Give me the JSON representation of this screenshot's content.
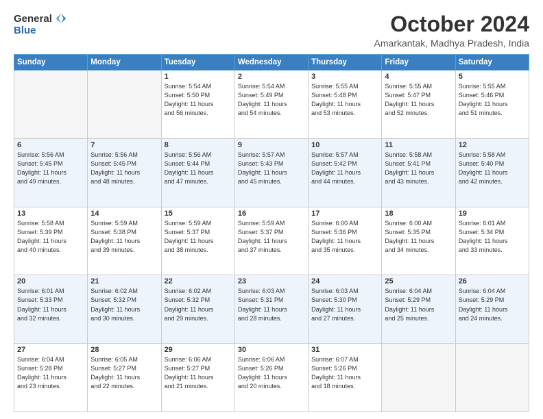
{
  "logo": {
    "general": "General",
    "blue": "Blue"
  },
  "header": {
    "month_year": "October 2024",
    "location": "Amarkantak, Madhya Pradesh, India"
  },
  "weekdays": [
    "Sunday",
    "Monday",
    "Tuesday",
    "Wednesday",
    "Thursday",
    "Friday",
    "Saturday"
  ],
  "weeks": [
    [
      {
        "day": "",
        "info": ""
      },
      {
        "day": "",
        "info": ""
      },
      {
        "day": "1",
        "info": "Sunrise: 5:54 AM\nSunset: 5:50 PM\nDaylight: 11 hours\nand 56 minutes."
      },
      {
        "day": "2",
        "info": "Sunrise: 5:54 AM\nSunset: 5:49 PM\nDaylight: 11 hours\nand 54 minutes."
      },
      {
        "day": "3",
        "info": "Sunrise: 5:55 AM\nSunset: 5:48 PM\nDaylight: 11 hours\nand 53 minutes."
      },
      {
        "day": "4",
        "info": "Sunrise: 5:55 AM\nSunset: 5:47 PM\nDaylight: 11 hours\nand 52 minutes."
      },
      {
        "day": "5",
        "info": "Sunrise: 5:55 AM\nSunset: 5:46 PM\nDaylight: 11 hours\nand 51 minutes."
      }
    ],
    [
      {
        "day": "6",
        "info": "Sunrise: 5:56 AM\nSunset: 5:45 PM\nDaylight: 11 hours\nand 49 minutes."
      },
      {
        "day": "7",
        "info": "Sunrise: 5:56 AM\nSunset: 5:45 PM\nDaylight: 11 hours\nand 48 minutes."
      },
      {
        "day": "8",
        "info": "Sunrise: 5:56 AM\nSunset: 5:44 PM\nDaylight: 11 hours\nand 47 minutes."
      },
      {
        "day": "9",
        "info": "Sunrise: 5:57 AM\nSunset: 5:43 PM\nDaylight: 11 hours\nand 45 minutes."
      },
      {
        "day": "10",
        "info": "Sunrise: 5:57 AM\nSunset: 5:42 PM\nDaylight: 11 hours\nand 44 minutes."
      },
      {
        "day": "11",
        "info": "Sunrise: 5:58 AM\nSunset: 5:41 PM\nDaylight: 11 hours\nand 43 minutes."
      },
      {
        "day": "12",
        "info": "Sunrise: 5:58 AM\nSunset: 5:40 PM\nDaylight: 11 hours\nand 42 minutes."
      }
    ],
    [
      {
        "day": "13",
        "info": "Sunrise: 5:58 AM\nSunset: 5:39 PM\nDaylight: 11 hours\nand 40 minutes."
      },
      {
        "day": "14",
        "info": "Sunrise: 5:59 AM\nSunset: 5:38 PM\nDaylight: 11 hours\nand 39 minutes."
      },
      {
        "day": "15",
        "info": "Sunrise: 5:59 AM\nSunset: 5:37 PM\nDaylight: 11 hours\nand 38 minutes."
      },
      {
        "day": "16",
        "info": "Sunrise: 5:59 AM\nSunset: 5:37 PM\nDaylight: 11 hours\nand 37 minutes."
      },
      {
        "day": "17",
        "info": "Sunrise: 6:00 AM\nSunset: 5:36 PM\nDaylight: 11 hours\nand 35 minutes."
      },
      {
        "day": "18",
        "info": "Sunrise: 6:00 AM\nSunset: 5:35 PM\nDaylight: 11 hours\nand 34 minutes."
      },
      {
        "day": "19",
        "info": "Sunrise: 6:01 AM\nSunset: 5:34 PM\nDaylight: 11 hours\nand 33 minutes."
      }
    ],
    [
      {
        "day": "20",
        "info": "Sunrise: 6:01 AM\nSunset: 5:33 PM\nDaylight: 11 hours\nand 32 minutes."
      },
      {
        "day": "21",
        "info": "Sunrise: 6:02 AM\nSunset: 5:32 PM\nDaylight: 11 hours\nand 30 minutes."
      },
      {
        "day": "22",
        "info": "Sunrise: 6:02 AM\nSunset: 5:32 PM\nDaylight: 11 hours\nand 29 minutes."
      },
      {
        "day": "23",
        "info": "Sunrise: 6:03 AM\nSunset: 5:31 PM\nDaylight: 11 hours\nand 28 minutes."
      },
      {
        "day": "24",
        "info": "Sunrise: 6:03 AM\nSunset: 5:30 PM\nDaylight: 11 hours\nand 27 minutes."
      },
      {
        "day": "25",
        "info": "Sunrise: 6:04 AM\nSunset: 5:29 PM\nDaylight: 11 hours\nand 25 minutes."
      },
      {
        "day": "26",
        "info": "Sunrise: 6:04 AM\nSunset: 5:29 PM\nDaylight: 11 hours\nand 24 minutes."
      }
    ],
    [
      {
        "day": "27",
        "info": "Sunrise: 6:04 AM\nSunset: 5:28 PM\nDaylight: 11 hours\nand 23 minutes."
      },
      {
        "day": "28",
        "info": "Sunrise: 6:05 AM\nSunset: 5:27 PM\nDaylight: 11 hours\nand 22 minutes."
      },
      {
        "day": "29",
        "info": "Sunrise: 6:06 AM\nSunset: 5:27 PM\nDaylight: 11 hours\nand 21 minutes."
      },
      {
        "day": "30",
        "info": "Sunrise: 6:06 AM\nSunset: 5:26 PM\nDaylight: 11 hours\nand 20 minutes."
      },
      {
        "day": "31",
        "info": "Sunrise: 6:07 AM\nSunset: 5:26 PM\nDaylight: 11 hours\nand 18 minutes."
      },
      {
        "day": "",
        "info": ""
      },
      {
        "day": "",
        "info": ""
      }
    ]
  ]
}
